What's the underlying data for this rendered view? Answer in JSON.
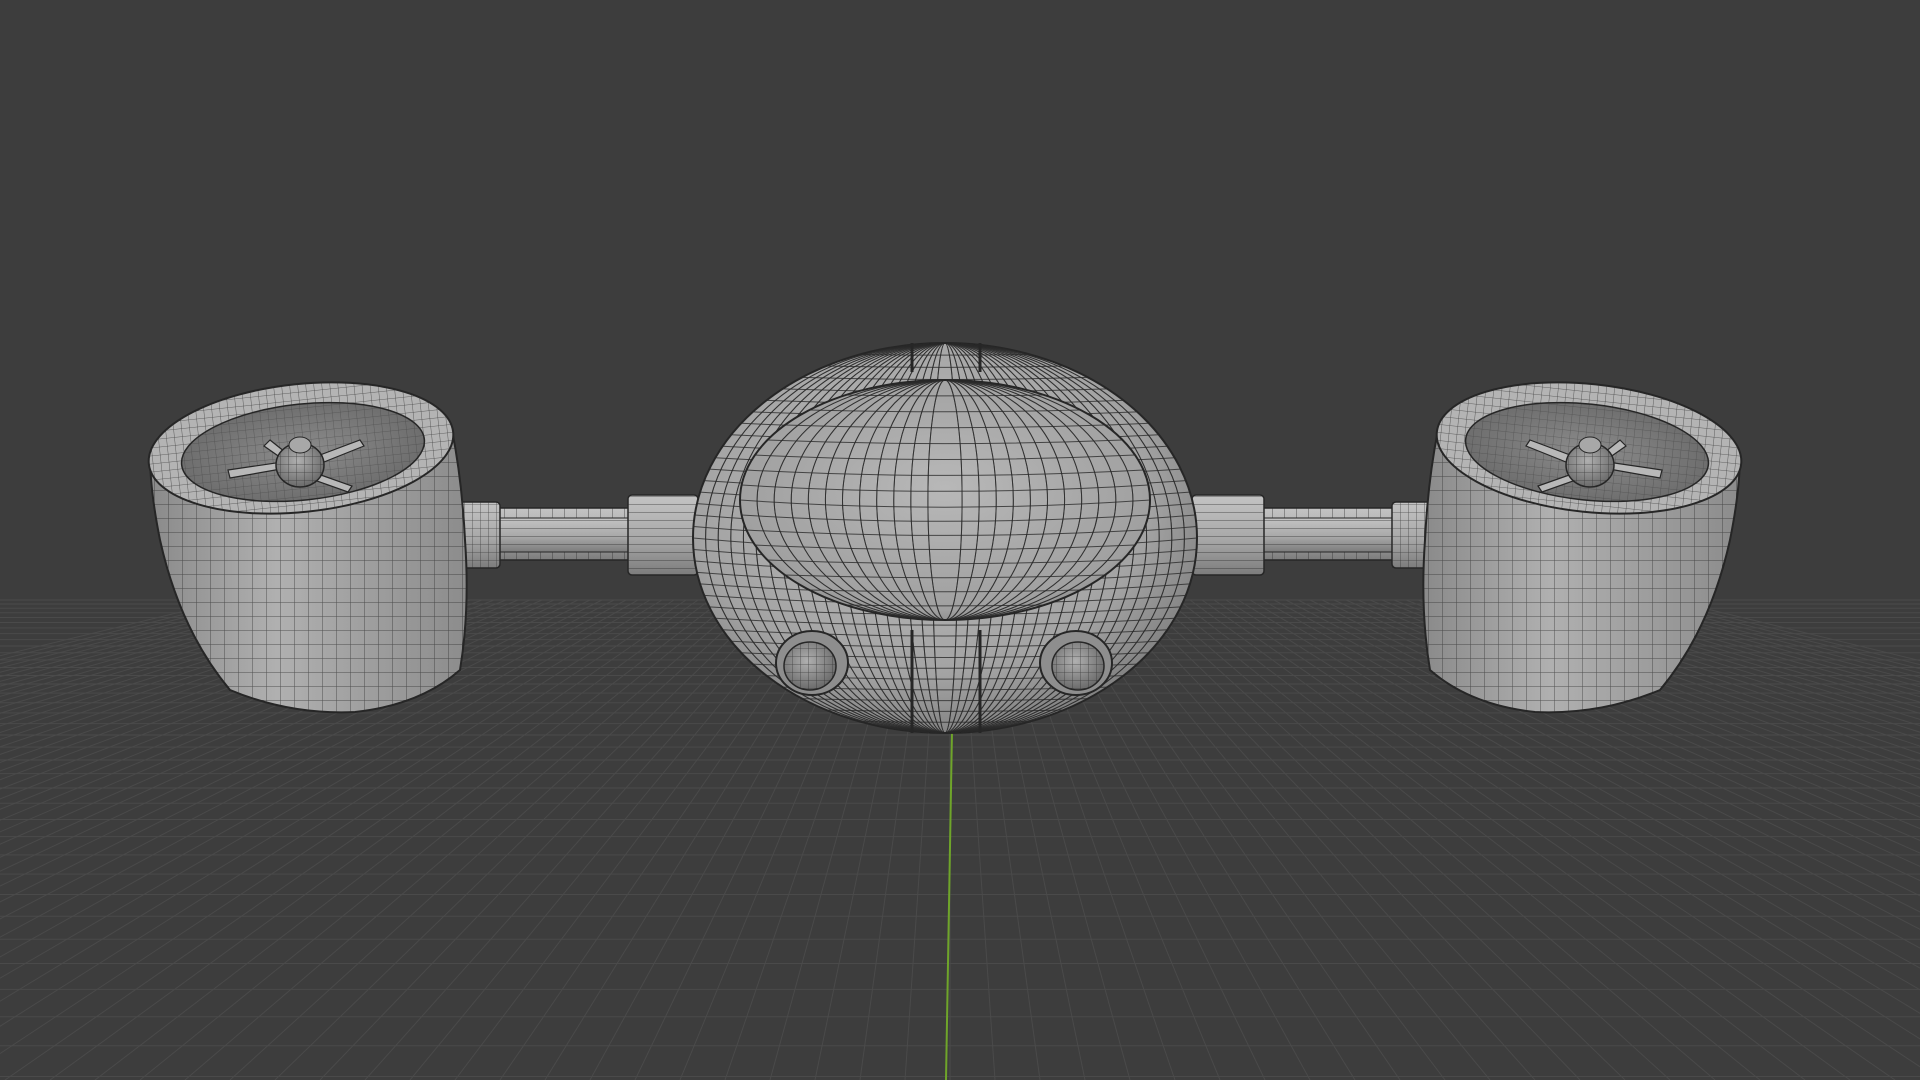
{
  "viewport": {
    "view_mode": "solid-wireframe",
    "background_color": "#3d3d3d",
    "floor_grid_color": "#4a4a4a",
    "y_axis_color": "#6fa52a",
    "mesh_base_color": "#a6a6a6",
    "mesh_wire_color": "#2a2a2a",
    "grid": true,
    "overlays": {
      "wireframe": true,
      "floor": true,
      "y_axis": true
    }
  },
  "scene_objects": [
    {
      "name": "central-pod-body",
      "icon": "sphere-mesh"
    },
    {
      "name": "cockpit-canopy",
      "icon": "ellipsoid-mesh"
    },
    {
      "name": "left-engine-nacelle",
      "icon": "cylinder-mesh"
    },
    {
      "name": "right-engine-nacelle",
      "icon": "cylinder-mesh"
    },
    {
      "name": "left-strut",
      "icon": "cylinder-mesh"
    },
    {
      "name": "right-strut",
      "icon": "cylinder-mesh"
    },
    {
      "name": "left-sensor-sphere",
      "icon": "sphere-mesh"
    },
    {
      "name": "right-sensor-sphere",
      "icon": "sphere-mesh"
    }
  ]
}
